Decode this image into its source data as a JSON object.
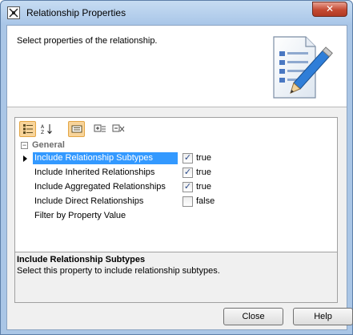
{
  "window": {
    "title": "Relationship Properties",
    "close_glyph": "✕"
  },
  "header": {
    "text": "Select properties of the relationship."
  },
  "toolbar": {
    "icons": [
      "categorized-view-icon",
      "sort-alphabetical-icon",
      "filter-icon",
      "expand-all-icon",
      "collapse-all-icon"
    ]
  },
  "properties": {
    "group_toggle": "−",
    "group_label": "General",
    "items": [
      {
        "name": "Include Relationship Subtypes",
        "checked": true,
        "value": "true"
      },
      {
        "name": "Include Inherited Relationships",
        "checked": true,
        "value": "true"
      },
      {
        "name": "Include Aggregated Relationships",
        "checked": true,
        "value": "true"
      },
      {
        "name": "Include Direct Relationships",
        "checked": false,
        "value": "false"
      },
      {
        "name": "Filter by Property Value",
        "checked": null,
        "value": ""
      }
    ],
    "check_glyph": "✓"
  },
  "description": {
    "title": "Include Relationship Subtypes",
    "text": "Select this property to include relationship subtypes."
  },
  "buttons": {
    "close": "Close",
    "help": "Help"
  },
  "colors": {
    "selection": "#3399ff",
    "active_tool": "#f8d49a"
  }
}
